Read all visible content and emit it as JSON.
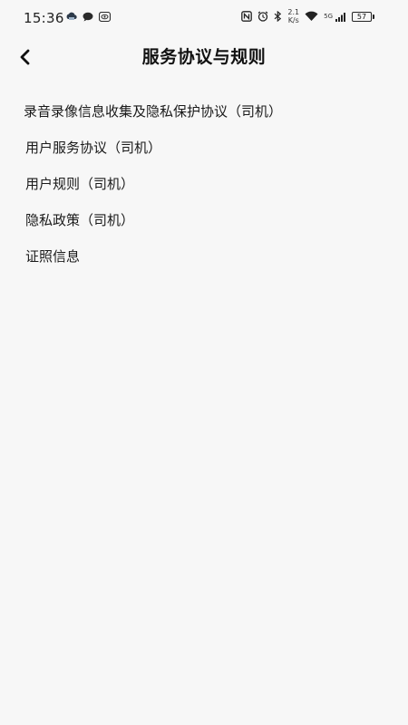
{
  "status_bar": {
    "time": "15:36",
    "left_icons": [
      "cloud-notification-icon",
      "message-icon",
      "eye-icon"
    ],
    "right_icons": [
      "nfc-icon",
      "alarm-icon",
      "bluetooth-icon",
      "wifi-icon",
      "signal-icon"
    ],
    "net_speed_value": "2.1",
    "net_speed_unit": "K/s",
    "signal_label": "5G",
    "battery": "57"
  },
  "header": {
    "title": "服务协议与规则",
    "back_icon": "chevron-left-icon"
  },
  "list": {
    "items": [
      {
        "label": "录音录像信息收集及隐私保护协议（司机）"
      },
      {
        "label": "用户服务协议（司机）"
      },
      {
        "label": "用户规则（司机）"
      },
      {
        "label": "隐私政策（司机）"
      },
      {
        "label": "证照信息"
      }
    ]
  }
}
